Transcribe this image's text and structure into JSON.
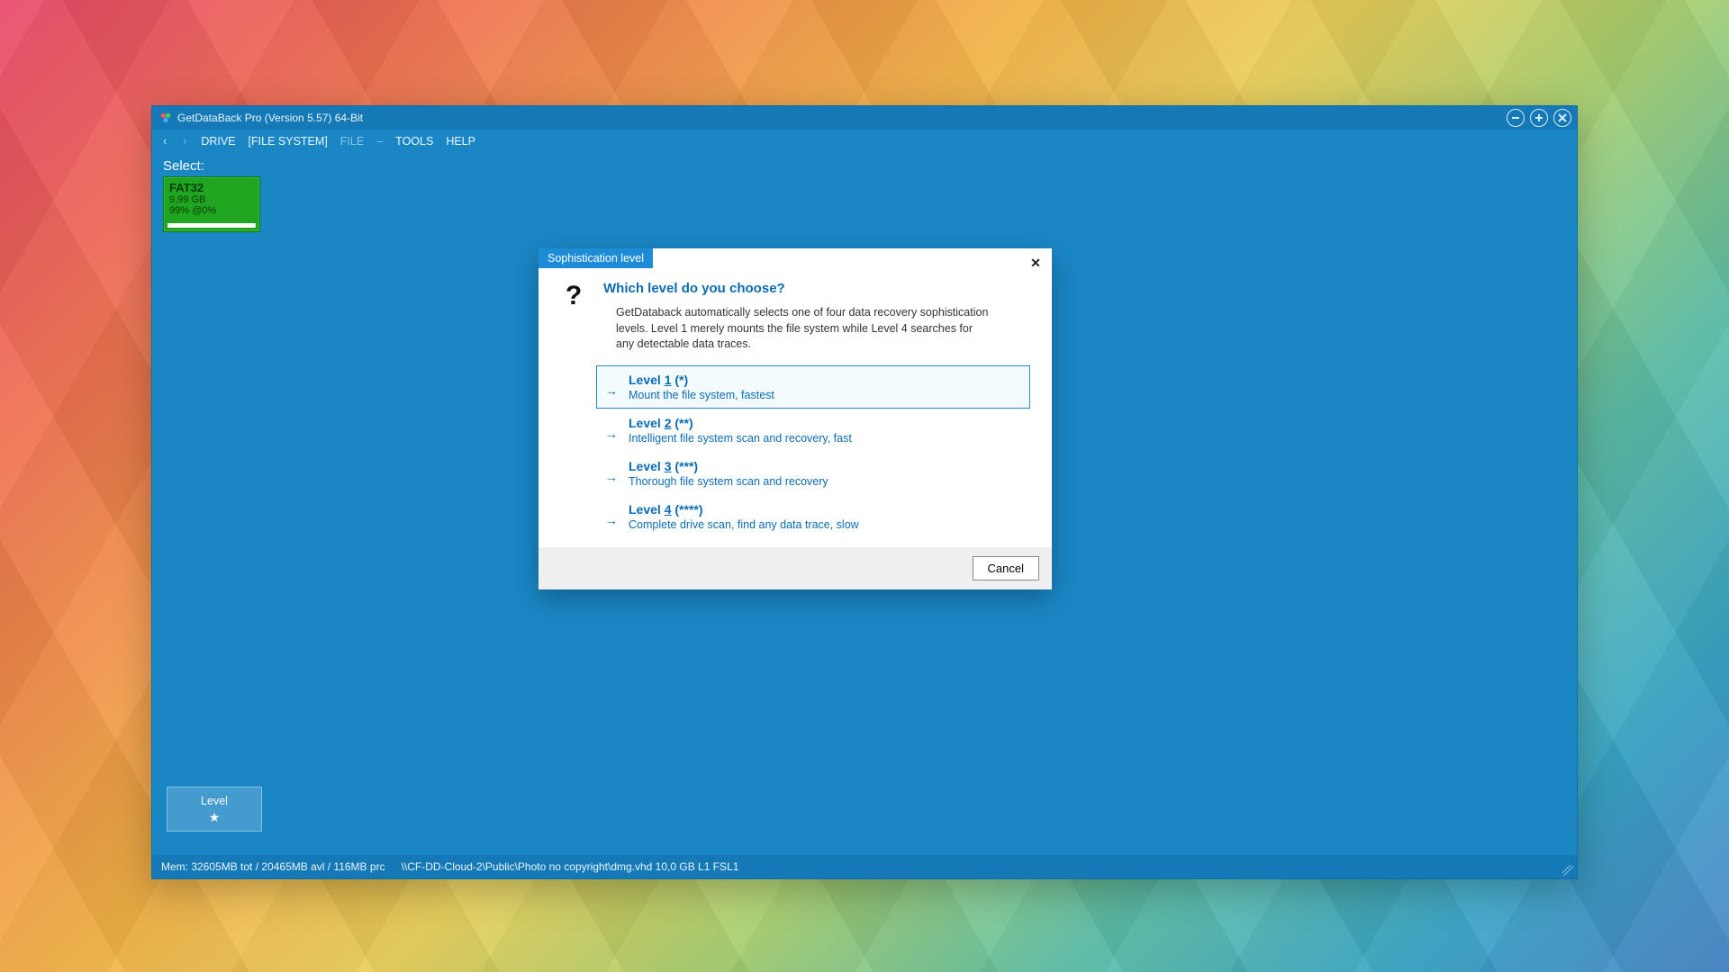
{
  "window": {
    "title": "GetDataBack Pro (Version 5.57) 64-Bit"
  },
  "menubar": {
    "back": "‹",
    "forward": "›",
    "items": [
      {
        "label": "DRIVE",
        "disabled": false,
        "bracketed": false
      },
      {
        "label": "FILE SYSTEM",
        "disabled": false,
        "bracketed": true
      },
      {
        "label": "FILE",
        "disabled": true,
        "bracketed": false
      },
      {
        "label": "TOOLS",
        "disabled": false,
        "bracketed": false
      },
      {
        "label": "HELP",
        "disabled": false,
        "bracketed": false
      }
    ]
  },
  "select_label": "Select:",
  "drive": {
    "fs": "FAT32",
    "size": "9,99 GB",
    "percent": "99% @0%"
  },
  "level_button": {
    "label": "Level",
    "star": "★"
  },
  "statusbar": {
    "mem": "Mem: 32605MB tot / 20465MB avl / 116MB prc",
    "path": "\\\\CF-DD-Cloud-2\\Public\\Photo no copyright\\dmg.vhd 10,0 GB L1 FSL1"
  },
  "dialog": {
    "tab": "Sophistication level",
    "title": "Which level do you choose?",
    "description": "GetDataback automatically selects one of four data recovery sophistication levels. Level 1 merely mounts the file system while Level 4 searches for any detectable data traces.",
    "levels": [
      {
        "title_pre": "Level ",
        "hot": "1",
        "title_post": " (*)",
        "desc": "Mount the file system, fastest",
        "selected": true
      },
      {
        "title_pre": "Level ",
        "hot": "2",
        "title_post": " (**)",
        "desc": "Intelligent file system scan and recovery, fast",
        "selected": false
      },
      {
        "title_pre": "Level ",
        "hot": "3",
        "title_post": " (***)",
        "desc": "Thorough file system scan and recovery",
        "selected": false
      },
      {
        "title_pre": "Level ",
        "hot": "4",
        "title_post": " (****)",
        "desc": "Complete drive scan, find any data trace, slow",
        "selected": false
      }
    ],
    "cancel": "Cancel"
  }
}
